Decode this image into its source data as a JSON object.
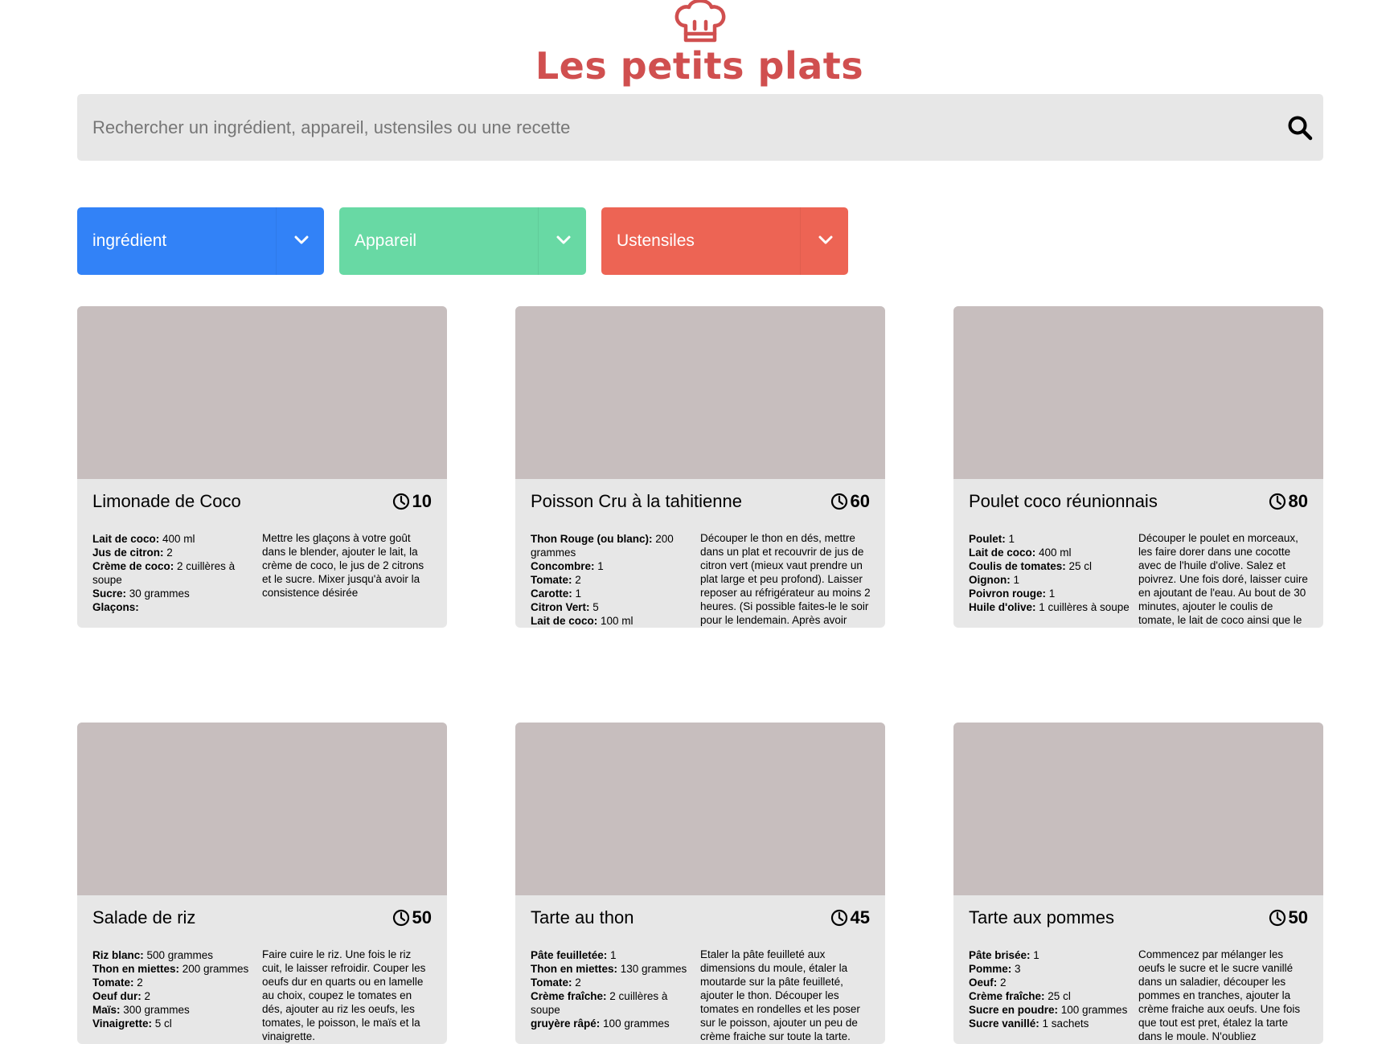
{
  "app": {
    "title": "Les petits plats",
    "logo_icon": "chef-hat-icon",
    "brand_color": "#D04F4F"
  },
  "search": {
    "placeholder": "Rechercher un ingrédient, appareil, ustensiles ou une recette",
    "value": "",
    "icon": "search-icon"
  },
  "filters": [
    {
      "label": "ingrédient",
      "color": "#3282F7",
      "icon": "chevron-down-icon"
    },
    {
      "label": "Appareil",
      "color": "#68D9A4",
      "icon": "chevron-down-icon"
    },
    {
      "label": "Ustensiles",
      "color": "#ED6454",
      "icon": "chevron-down-icon"
    }
  ],
  "recipes": [
    {
      "name": "Limonade de Coco",
      "time": "10",
      "ingredients": [
        {
          "name": "Lait de coco",
          "qty": "400 ml"
        },
        {
          "name": "Jus de citron",
          "qty": "2"
        },
        {
          "name": "Crème de coco",
          "qty": "2 cuillères à soupe"
        },
        {
          "name": "Sucre",
          "qty": "30 grammes"
        },
        {
          "name": "Glaçons",
          "qty": ""
        }
      ],
      "description": "Mettre les glaçons à votre goût dans le blender, ajouter le lait, la crème de coco, le jus de 2 citrons et le sucre. Mixer jusqu'à avoir la consistence désirée"
    },
    {
      "name": "Poisson Cru à la tahitienne",
      "time": "60",
      "ingredients": [
        {
          "name": "Thon Rouge (ou blanc)",
          "qty": "200 grammes"
        },
        {
          "name": "Concombre",
          "qty": "1"
        },
        {
          "name": "Tomate",
          "qty": "2"
        },
        {
          "name": "Carotte",
          "qty": "1"
        },
        {
          "name": "Citron Vert",
          "qty": "5"
        },
        {
          "name": "Lait de coco",
          "qty": "100 ml"
        }
      ],
      "description": "Découper le thon en dés, mettre dans un plat et recouvrir de jus de citron vert (mieux vaut prendre un plat large et peu profond). Laisser reposer au réfrigérateur au moins 2 heures. (Si possible faites-le le soir pour le lendemain. Après avoir laiss…"
    },
    {
      "name": "Poulet coco réunionnais",
      "time": "80",
      "ingredients": [
        {
          "name": "Poulet",
          "qty": "1"
        },
        {
          "name": "Lait de coco",
          "qty": "400 ml"
        },
        {
          "name": "Coulis de tomates",
          "qty": "25 cl"
        },
        {
          "name": "Oignon",
          "qty": "1"
        },
        {
          "name": "Poivron rouge",
          "qty": "1"
        },
        {
          "name": "Huile d'olive",
          "qty": "1 cuillères à soupe"
        }
      ],
      "description": "Découper le poulet en morceaux, les faire dorer dans une cocotte avec de l'huile d'olive. Salez et poivrez. Une fois doré, laisser cuire en ajoutant de l'eau. Au bout de 30 minutes, ajouter le coulis de tomate, le lait de coco ainsi que le poivro…"
    },
    {
      "name": "Salade de riz",
      "time": "50",
      "ingredients": [
        {
          "name": "Riz blanc",
          "qty": "500 grammes"
        },
        {
          "name": "Thon en miettes",
          "qty": "200 grammes"
        },
        {
          "name": "Tomate",
          "qty": "2"
        },
        {
          "name": "Oeuf dur",
          "qty": "2"
        },
        {
          "name": "Maïs",
          "qty": "300 grammes"
        },
        {
          "name": "Vinaigrette",
          "qty": "5 cl"
        }
      ],
      "description": "Faire cuire le riz. Une fois le riz cuit, le laisser refroidir. Couper les oeufs dur en quarts ou en lamelle au choix, coupez le tomates en dés, ajouter au riz les oeufs, les tomates, le poisson, le maïs et la vinaigrette."
    },
    {
      "name": "Tarte au thon",
      "time": "45",
      "ingredients": [
        {
          "name": "Pâte feuilletée",
          "qty": "1"
        },
        {
          "name": "Thon en miettes",
          "qty": "130 grammes"
        },
        {
          "name": "Tomate",
          "qty": "2"
        },
        {
          "name": "Crème fraîche",
          "qty": "2 cuillères à soupe"
        },
        {
          "name": "gruyère râpé",
          "qty": "100 grammes"
        }
      ],
      "description": "Etaler la pâte feuilleté aux dimensions du moule, étaler la moutarde sur la pâte feuilleté, ajouter le thon. Découper les tomates en rondelles et les poser sur le poisson, ajouter un peu de crème fraiche sur toute la tarte."
    },
    {
      "name": "Tarte aux pommes",
      "time": "50",
      "ingredients": [
        {
          "name": "Pâte brisée",
          "qty": "1"
        },
        {
          "name": "Pomme",
          "qty": "3"
        },
        {
          "name": "Oeuf",
          "qty": "2"
        },
        {
          "name": "Crème fraîche",
          "qty": "25 cl"
        },
        {
          "name": "Sucre en poudre",
          "qty": "100 grammes"
        },
        {
          "name": "Sucre vanillé",
          "qty": "1 sachets"
        }
      ],
      "description": "Commencez par mélanger les oeufs le sucre et le sucre vanillé dans un saladier, découper les pommes en tranches, ajouter la crème fraiche aux oeufs. Une fois que tout est pret, étalez la tarte dans le moule. N'oubliez"
    }
  ]
}
